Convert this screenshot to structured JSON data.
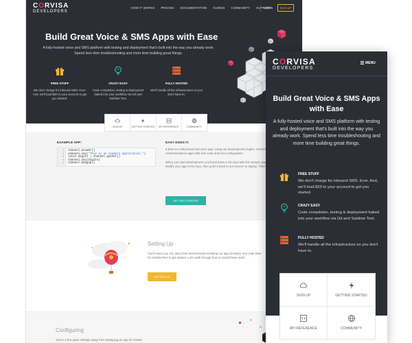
{
  "brand": {
    "name_pre": "C",
    "name_o": "O",
    "name_post": "RVISA",
    "tagline": "DEVELOPERS"
  },
  "desktop": {
    "nav": {
      "items": [
        "HOW IT WORKS",
        "PRICING",
        "DOCUMENTATION",
        "GUIDES",
        "COMMUNITY",
        "SUPPORT"
      ],
      "login": "LOGIN",
      "signup": "SIGN UP"
    },
    "hero": {
      "title": "Build Great Voice & SMS Apps with Ease",
      "subtitle": "A fully-hosted voice and SMS platform with testing and deployment that's built into the way you already work. Spend less time troubleshooting and more time building great things.",
      "features": [
        {
          "title": "FREE STUFF",
          "desc": "We don't charge for inbound SMS. Ever. And, we'll load $20 to your account to get you started."
        },
        {
          "title": "CRAZY EASY",
          "desc": "Code completion, testing & deployment baked into your workflow via Git and Sublime Text."
        },
        {
          "title": "FULLY HOSTED",
          "desc": "We'll handle all the infrastructure so you don't have to."
        }
      ]
    },
    "tabs": [
      "SIGN UP",
      "GETTING STARTED",
      "API REFERENCE",
      "COMMUNITY"
    ],
    "example": {
      "label": "EXAMPLE APP:",
      "line_numbers": [
        "1",
        "2",
        "3",
        "4",
        "5"
      ],
      "code": {
        "l1": "channel.answer()",
        "l2_pre": "channel.say(",
        "l2_str": "\"This is an example application.\"",
        "l2_post": ")",
        "l3": "local digits = channel.gather()",
        "l4": "channel.say(digits)",
        "l5": "channel.hangup()"
      },
      "easy_heading": "EASY DOES IT.",
      "easy_p1": "5 lines to a fully-functional voice app. Using our development engine, Summit, you can build powerful communications apps with less code and less configuration.",
      "easy_p2": "When you start development, you'll pull down a Git repo with this sample app already written for you. Modify your app in the repo, then push it back to our servers to deploy. That's it! Want to learn more?",
      "button": "GETTING STARTED"
    },
    "setup": {
      "heading": "Setting Up",
      "text": "You'll need Lua, Git, and a few Summit tools including our app simulator and code linter for SublimeText to get started. Let's walk through how to install these tools:",
      "button": "SETTING UP"
    },
    "configuring": {
      "heading": "Configuring",
      "text": "You're a few quick settings away from deploying an app for instant"
    }
  },
  "mobile": {
    "menu": "MENU",
    "title": "Build Great Voice & SMS Apps with Ease",
    "subtitle": "A fully-hosted voice and SMS platform with testing and deployment that's built into the way you already work. Spend less time troubleshooting and more time building great things.",
    "features": [
      {
        "title": "FREE STUFF",
        "desc": "We don't charge for inbound SMS. Ever. And, we'll load $20 to your account to get you started."
      },
      {
        "title": "CRAZY EASY",
        "desc": "Code completion, testing & deployment baked into your workflow via Git and Sublime Text."
      },
      {
        "title": "FULLY HOSTED",
        "desc": "We'll handle all the infrastructure so you don't have to."
      }
    ],
    "tabs": [
      "SIGN UP",
      "GETTING STARTED",
      "API REFERENCE",
      "COMMUNITY"
    ]
  },
  "icons": {
    "free": "gift-icon",
    "easy": "lightbulb-icon",
    "hosted": "server-icon",
    "signup": "cloud-icon",
    "getting_started": "lightning-icon",
    "api": "code-brackets-icon",
    "community": "globe-icon"
  },
  "colors": {
    "hero_bg": "#2b2e35",
    "accent_pink": "#e63a5f",
    "accent_yellow": "#f2b632",
    "accent_teal": "#2cb3a6",
    "server_orange": "#e0683a"
  }
}
